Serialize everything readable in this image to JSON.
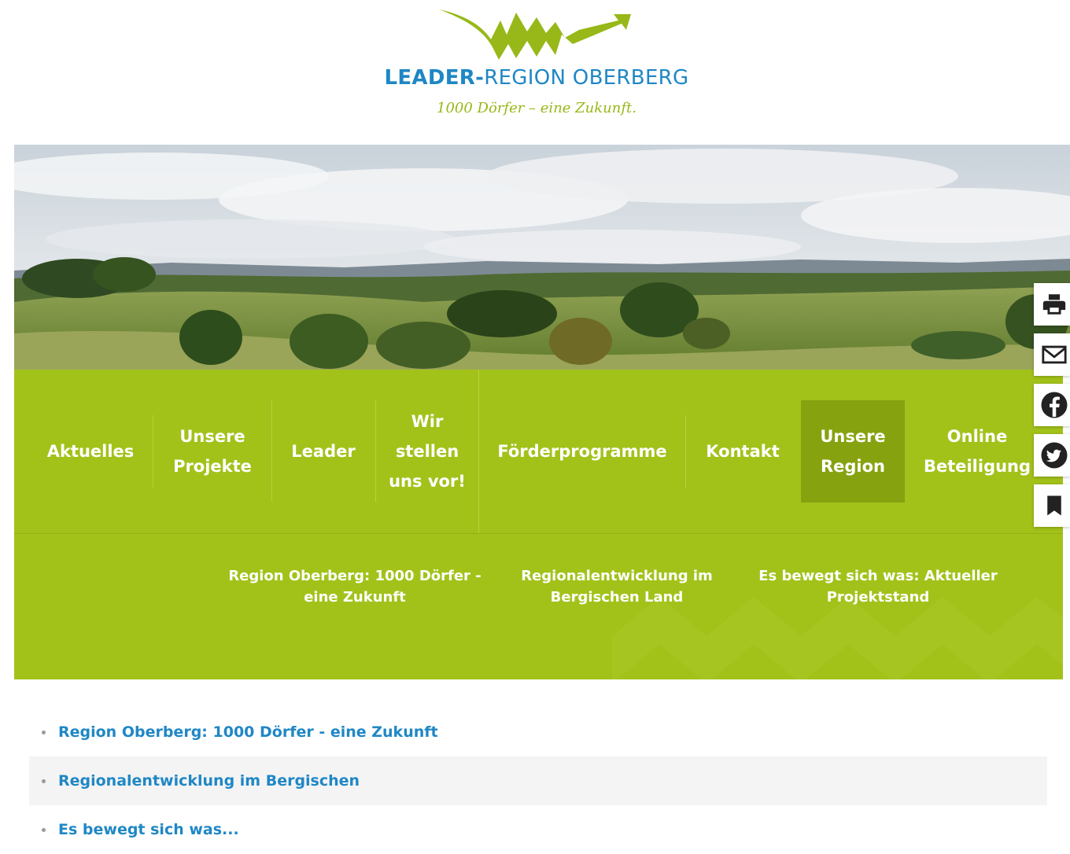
{
  "logo": {
    "title_bold": "LEADER-",
    "title_rest": "REGION OBERBERG",
    "tagline": "1000 Dörfer – eine Zukunft."
  },
  "hero": {
    "alt": "landscape-photo"
  },
  "nav": {
    "items": [
      {
        "label": "Aktuelles"
      },
      {
        "label": "Unsere Projekte"
      },
      {
        "label": "Leader"
      },
      {
        "label": "Wir stellen uns vor!"
      },
      {
        "label": "Förderprogramme"
      },
      {
        "label": "Kontakt"
      },
      {
        "label": "Unsere Region",
        "active": true
      },
      {
        "label": "Online Beteiligung"
      }
    ]
  },
  "subnav": {
    "items": [
      {
        "label": "Region Oberberg: 1000 Dörfer - eine Zukunft"
      },
      {
        "label": "Regionalentwicklung im Bergischen Land"
      },
      {
        "label": "Es bewegt sich was: Aktueller Projektstand"
      }
    ]
  },
  "sidebar": {
    "buttons": [
      "print-icon",
      "mail-icon",
      "facebook-icon",
      "twitter-icon",
      "bookmark-icon"
    ]
  },
  "content": {
    "links": [
      {
        "label": "Region Oberberg: 1000 Dörfer - eine Zukunft"
      },
      {
        "label": "Regionalentwicklung im Bergischen"
      },
      {
        "label": "Es bewegt sich was..."
      }
    ]
  },
  "colors": {
    "brand_green": "#a2c21a",
    "active_green": "#87a20f",
    "link_blue": "#1f87c5"
  }
}
